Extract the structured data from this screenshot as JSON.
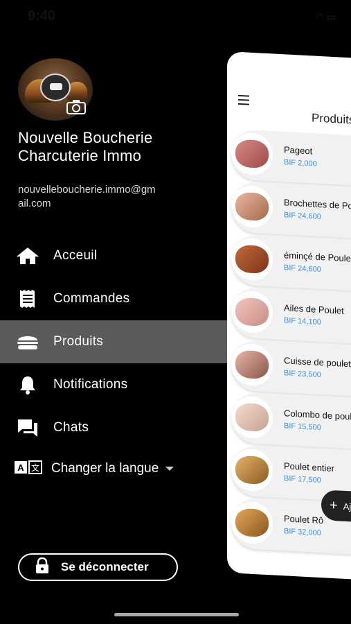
{
  "status": {
    "time": "9:40"
  },
  "profile": {
    "name": "Nouvelle Boucherie Charcuterie Immo",
    "email": "nouvelleboucherie.immo@gmail.com"
  },
  "menu": {
    "items": [
      {
        "label": "Acceuil",
        "icon": "home-icon"
      },
      {
        "label": "Commandes",
        "icon": "receipt-icon"
      },
      {
        "label": "Produits",
        "icon": "burger-icon",
        "active": true
      },
      {
        "label": "Notifications",
        "icon": "bell-icon"
      },
      {
        "label": "Chats",
        "icon": "chat-icon"
      }
    ],
    "language_label": "Changer la langue",
    "logout_label": "Se déconnecter"
  },
  "preview": {
    "title": "Produits",
    "products": [
      {
        "name": "Pageot",
        "price": "BIF 2,000"
      },
      {
        "name": "Brochettes de Por",
        "price": "BIF 24,600"
      },
      {
        "name": "éminçé de Poulet",
        "price": "BIF 24,600"
      },
      {
        "name": "Ailes de Poulet",
        "price": "BIF 14,100"
      },
      {
        "name": "Cuisse de poulet",
        "price": "BIF 23,500"
      },
      {
        "name": "Colombo de poule",
        "price": "BIF 15,500"
      },
      {
        "name": "Poulet entier",
        "price": "BIF 17,500"
      },
      {
        "name": "Poulet Rô",
        "price": "BIF 32,000"
      }
    ],
    "fab_label": "Aj"
  },
  "colors": {
    "accent_price": "#3b8ee0",
    "active_item_bg": "#5b5b5b",
    "background": "#000000"
  }
}
